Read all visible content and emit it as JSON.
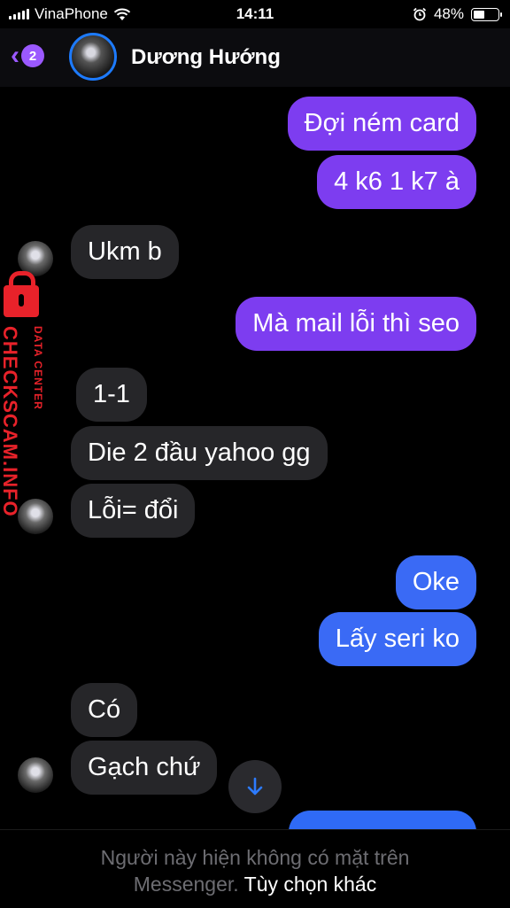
{
  "status_bar": {
    "carrier": "VinaPhone",
    "time": "14:11",
    "battery_percent": "48%",
    "battery_level": 0.48
  },
  "header": {
    "back_badge": "2",
    "contact_name": "Dương Hướng"
  },
  "messages": [
    {
      "side": "out",
      "text": "Đợi ném card"
    },
    {
      "side": "out",
      "text": "4 k6 1 k7 à"
    },
    {
      "side": "in",
      "text": "Ukm b"
    },
    {
      "side": "out",
      "text": "Mà mail lỗi thì seo"
    },
    {
      "side": "in",
      "text": "1-1"
    },
    {
      "side": "in",
      "text": "Die 2 đầu yahoo gg"
    },
    {
      "side": "in",
      "text": "Lỗi= đổi"
    },
    {
      "side": "out",
      "text": "Oke"
    },
    {
      "side": "out",
      "text": "Lấy seri ko"
    },
    {
      "side": "in",
      "text": "Có"
    },
    {
      "side": "in",
      "text": "Gạch chứ"
    }
  ],
  "watermark": {
    "main": "CHECKSCAM.INFO",
    "sub": "DATA CENTER"
  },
  "footer": {
    "line1": "Người này hiện không có mặt trên",
    "line2": "Messenger.",
    "link": "Tùy chọn khác"
  },
  "colors": {
    "accent_purple": "#9b59ff",
    "outgoing_purple": "#7d3df0",
    "outgoing_blue": "#3a6af5",
    "incoming_gray": "#262629",
    "watermark_red": "#e8222a"
  },
  "icons": [
    "wifi-icon",
    "signal-icon",
    "alarm-icon",
    "battery-icon",
    "back-chevron-icon",
    "scroll-down-arrow-icon",
    "lock-icon"
  ]
}
